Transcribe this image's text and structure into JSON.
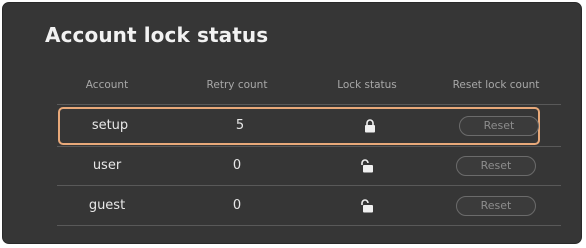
{
  "title": "Account lock status",
  "columns": {
    "account": "Account",
    "retry_count": "Retry count",
    "lock_status": "Lock status",
    "reset_lock_count": "Reset lock count"
  },
  "rows": [
    {
      "account": "setup",
      "retry_count": "5",
      "lock_icon": "locked-icon",
      "reset_label": "Reset"
    },
    {
      "account": "user",
      "retry_count": "0",
      "lock_icon": "unlocked-icon",
      "reset_label": "Reset"
    },
    {
      "account": "guest",
      "retry_count": "0",
      "lock_icon": "unlocked-icon",
      "reset_label": "Reset"
    }
  ],
  "colors": {
    "panel_bg": "#363636",
    "highlight_border": "#e8a97a",
    "text": "#e8e8e8",
    "header_text": "#a8a8a8"
  }
}
